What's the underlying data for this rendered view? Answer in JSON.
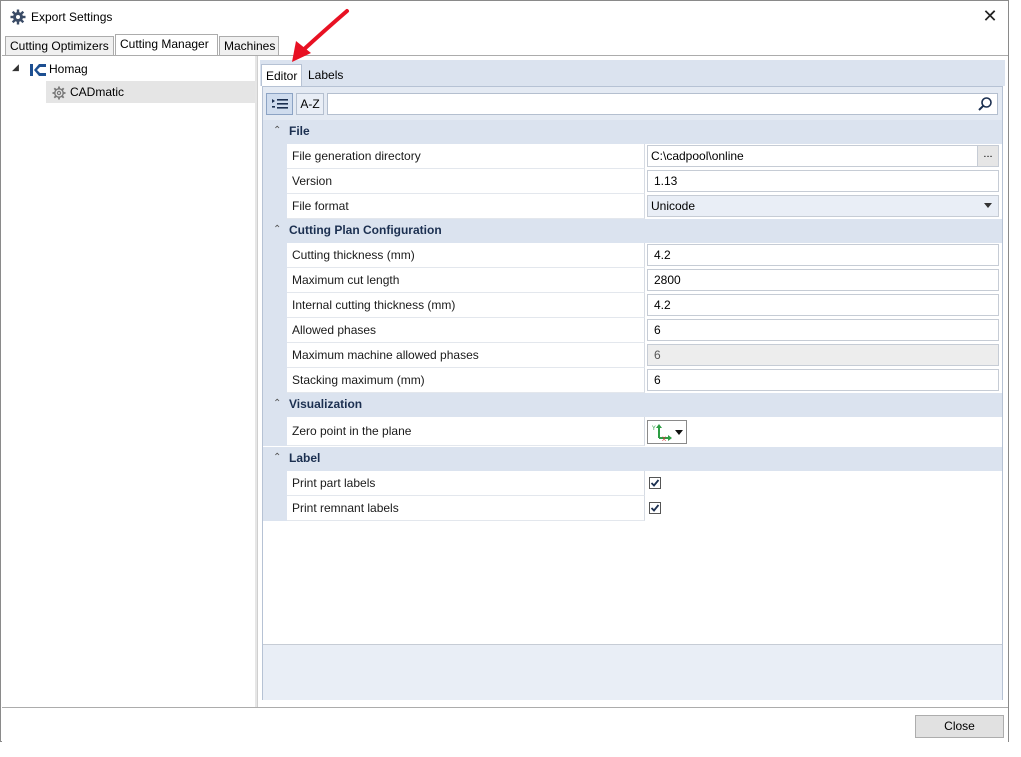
{
  "window": {
    "title": "Export Settings",
    "close_symbol": "✕"
  },
  "top_tabs": [
    {
      "label": "Cutting Optimizers"
    },
    {
      "label": "Cutting Manager"
    },
    {
      "label": "Machines"
    }
  ],
  "tree": {
    "root": {
      "label": "Homag",
      "icon": "homag-logo-icon"
    },
    "child": {
      "label": "CADmatic",
      "icon": "gear-icon"
    }
  },
  "editor_tabs": [
    {
      "label": "Editor"
    },
    {
      "label": "Labels"
    }
  ],
  "toolbar": {
    "categorized_label": "categorized",
    "az_label": "A-Z",
    "search_placeholder": ""
  },
  "categories": {
    "file": {
      "label": "File",
      "rows": [
        {
          "name": "File generation directory",
          "value": "C:\\cadpool\\online",
          "browse": "..."
        },
        {
          "name": "Version",
          "value": "1.13"
        },
        {
          "name": "File format",
          "value": "Unicode"
        }
      ]
    },
    "cutting": {
      "label": "Cutting Plan Configuration",
      "rows": [
        {
          "name": "Cutting thickness (mm)",
          "value": "4.2"
        },
        {
          "name": "Maximum cut length",
          "value": "2800"
        },
        {
          "name": "Internal cutting thickness (mm)",
          "value": "4.2"
        },
        {
          "name": "Allowed phases",
          "value": "6"
        },
        {
          "name": "Maximum machine allowed phases",
          "value": "6"
        },
        {
          "name": "Stacking maximum (mm)",
          "value": "6"
        }
      ]
    },
    "visualization": {
      "label": "Visualization",
      "rows": [
        {
          "name": "Zero point in the plane",
          "value_icon": "axis-origin-icon"
        }
      ]
    },
    "label": {
      "label": "Label",
      "rows": [
        {
          "name": "Print part labels",
          "checked": true
        },
        {
          "name": "Print remnant labels",
          "checked": true
        }
      ]
    }
  },
  "footer": {
    "close_label": "Close"
  },
  "colors": {
    "category_bg": "#dbe3ef",
    "accent_arrow": "#e81123",
    "category_text": "#1b2f50"
  }
}
